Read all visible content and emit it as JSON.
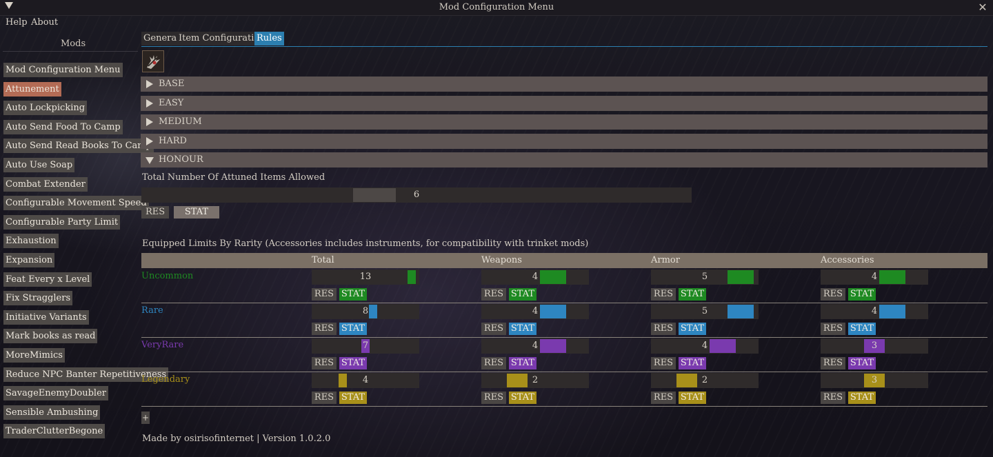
{
  "window": {
    "title": "Mod Configuration Menu"
  },
  "menubar": {
    "help": "Help",
    "about": "About"
  },
  "sidebar": {
    "title": "Mods",
    "active": "Attunement",
    "items": [
      "Mod Configuration Menu",
      "Attunement",
      "Auto Lockpicking",
      "Auto Send Food To Camp",
      "Auto Send Read Books To Camp",
      "Auto Use Soap",
      "Combat Extender",
      "Configurable Movement Speed",
      "Configurable Party Limit",
      "Exhaustion",
      "Expansion",
      "Feat Every x Level",
      "Fix Stragglers",
      "Initiative Variants",
      "Mark books as read",
      "MoreMimics",
      "Reduce NPC Banter Repetitiveness",
      "SavageEnemyDoubler",
      "Sensible Ambushing",
      "TraderClutterBegone"
    ]
  },
  "tabs": {
    "items": [
      "General",
      "Item Configuration",
      "Rules"
    ],
    "active": "Rules"
  },
  "difficulties": {
    "items": [
      "BASE",
      "EASY",
      "MEDIUM",
      "HARD",
      "HONOUR"
    ],
    "expanded": "HONOUR"
  },
  "attuned": {
    "label": "Total Number Of Attuned Items Allowed",
    "value": "6",
    "res": "RES",
    "stat": "STAT"
  },
  "limits": {
    "label": "Equipped Limits By Rarity (Accessories includes instruments, for compatibility with trinket mods)",
    "columns": [
      "Total",
      "Weapons",
      "Armor",
      "Accessories"
    ],
    "res": "RES",
    "stat": "STAT",
    "rows": [
      {
        "name": "Uncommon",
        "color": "#1e8a22",
        "values": [
          "13",
          "4",
          "5",
          "4"
        ]
      },
      {
        "name": "Rare",
        "color": "#2e86c1",
        "values": [
          "8",
          "4",
          "5",
          "4"
        ]
      },
      {
        "name": "VeryRare",
        "color": "#7a3aae",
        "values": [
          "7",
          "4",
          "4",
          "3"
        ]
      },
      {
        "name": "Legendary",
        "color": "#a8901a",
        "values": [
          "4",
          "2",
          "2",
          "3"
        ]
      }
    ]
  },
  "footer": {
    "text": "Made by osirisofinternet | Version 1.0.2.0"
  },
  "icons": {
    "collapse": "collapse-triangle-icon",
    "close": "close-icon",
    "mod": "attunement-hand-icon",
    "add": "plus-icon"
  }
}
